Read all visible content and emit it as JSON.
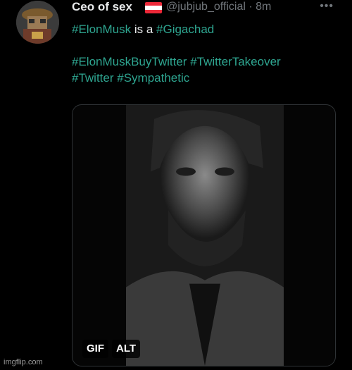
{
  "tweet": {
    "display_name": "Ceo of sex",
    "handle": "@jubjub_official",
    "time": "8m",
    "more_label": "•••",
    "line1": {
      "tag": "#ElonMusk",
      "middle": " is a ",
      "tag2": "#Gigachad"
    },
    "line3": {
      "tag1": "#ElonMuskBuyTwitter",
      "tag2": "#TwitterTakeover"
    },
    "line4": {
      "tag1": "#Twitter",
      "tag2": "#Sympathetic"
    }
  },
  "media": {
    "gif_label": "GIF",
    "alt_label": "ALT"
  },
  "watermark": "imgflip.com",
  "colors": {
    "background": "#000000",
    "text": "#e7e9ea",
    "muted": "#71767b",
    "hashtag": "#2ea590"
  },
  "icons": [
    "austria-flag-icon",
    "more-icon"
  ]
}
